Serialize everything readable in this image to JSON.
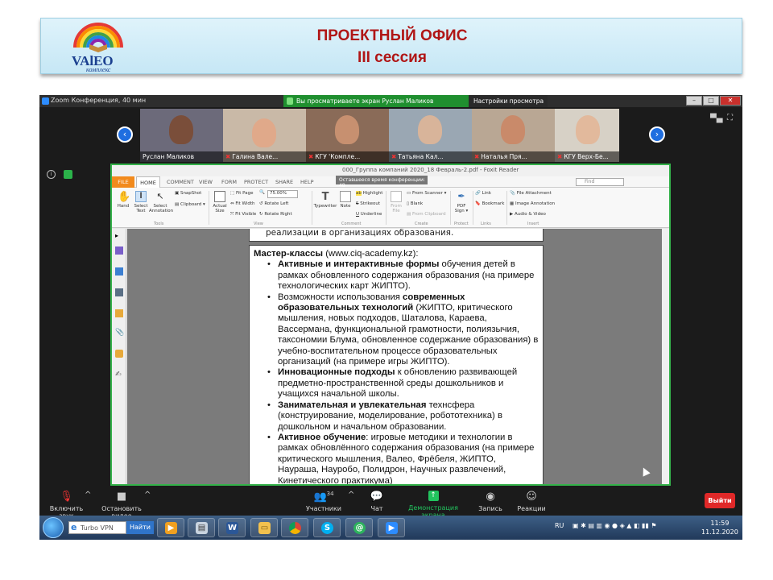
{
  "slide": {
    "title_line1": "ПРОЕКТНЫЙ ОФИС",
    "title_line2": "III сессия",
    "logo_text_main": "VAlEO",
    "logo_text_sub": "комплекс"
  },
  "zoom": {
    "window_title": "Zoom Конференция, 40 мин",
    "share_notice": "Вы просматриваете экран Руслан Маликов",
    "view_options": "Настройки просмотра",
    "participants": [
      {
        "name": "Руслан Маликов",
        "muted": false
      },
      {
        "name": "Галина Вале...",
        "muted": true
      },
      {
        "name": "КГУ 'Компле...",
        "muted": true
      },
      {
        "name": "Татьяна Кал...",
        "muted": true
      },
      {
        "name": "Наталья Пря...",
        "muted": true
      },
      {
        "name": "КГУ Верх-Бе...",
        "muted": true
      }
    ],
    "toolbar": {
      "unmute": "Включить звук",
      "stop_video": "Остановить видео",
      "participants": "Участники",
      "participants_count": "34",
      "chat": "Чат",
      "share_screen": "Демонстрация экрана",
      "record": "Запись",
      "reactions": "Реакции",
      "leave": "Выйти"
    }
  },
  "foxit": {
    "title": "000_Группа компаний 2020_18 Февраль-2.pdf - Foxit Reader",
    "timer": "Оставшееся время конференции: 48",
    "find_placeholder": "Find",
    "tabs": [
      "FILE",
      "HOME",
      "COMMENT",
      "VIEW",
      "FORM",
      "PROTECT",
      "SHARE",
      "HELP"
    ],
    "ribbon": {
      "hand": "Hand",
      "select_text": "Select Text",
      "select_annotation": "Select Annotation",
      "snapshot": "SnapShot",
      "clipboard": "Clipboard",
      "group_tools": "Tools",
      "actual_size": "Actual Size",
      "fit_page": "Fit Page",
      "fit_width": "Fit Width",
      "fit_visible": "Fit Visible",
      "zoom_value": "75.00%",
      "rotate_left": "Rotate Left",
      "rotate_right": "Rotate Right",
      "group_view": "View",
      "typewriter": "Typewriter",
      "note": "Note",
      "highlight": "Highlight",
      "strikeout": "Strikeout",
      "underline": "Underline",
      "group_comment": "Comment",
      "from_file": "From File",
      "from_scanner": "From Scanner",
      "blank": "Blank",
      "from_clipboard": "From Clipboard",
      "group_create": "Create",
      "pdf_sign": "PDF Sign",
      "group_protect": "Protect",
      "link": "Link",
      "bookmark": "Bookmark",
      "group_links": "Links",
      "file_attachment": "File Attachment",
      "image_annotation": "Image Annotation",
      "audio_video": "Audio & Video",
      "group_insert": "Insert"
    },
    "doc": {
      "prev_page_tail": "реализации в организациях образования.",
      "heading_bold": "Мастер-классы",
      "heading_rest": " (www.ciq-academy.kz):",
      "b1_bold": "Активные и интерактивные формы",
      "b1_rest": " обучения детей в рамках обновленного содержания образования (на примере технологических карт ЖИПТО).",
      "b2_pre": "Возможности использования ",
      "b2_bold": "современных образовательных технологий",
      "b2_rest": " (ЖИПТО, критического мышления, новых подходов, Шаталова, Караева, Вассермана, функциональной грамотности, полиязычия, таксономии Блума, обновленное содержание образования) в учебно-воспитательном процессе образовательных организаций (на примере игры ЖИПТО).",
      "b3_bold": "Инновационные подходы",
      "b3_rest": " к обновлению развивающей предметно-пространственной среды дошкольников и учащихся начальной школы.",
      "b4_bold": "Занимательная и увлекательная",
      "b4_rest": " технсфера (конструирование, моделирование, робототехника) в дошкольном и начальном образовании.",
      "b5_bold": "Активное обучение",
      "b5_rest": ": игровые методики и технологии в рамках обновлённого содержания образования (на примере критического мышления, Валео, Фрёбеля, ЖИПТО, Наураша, Науробо, Полидрон, Научных развлечений, Кинетического практикума)"
    }
  },
  "taskbar": {
    "vpn_search": "Turbo VPN",
    "go_button": "Найти",
    "lang": "RU",
    "time": "11:59",
    "date": "11.12.2020"
  },
  "colors": {
    "title_red": "#b01616",
    "zoom_green": "#22c35e",
    "foxit_orange": "#f28a1c",
    "leave_red": "#e02828"
  }
}
